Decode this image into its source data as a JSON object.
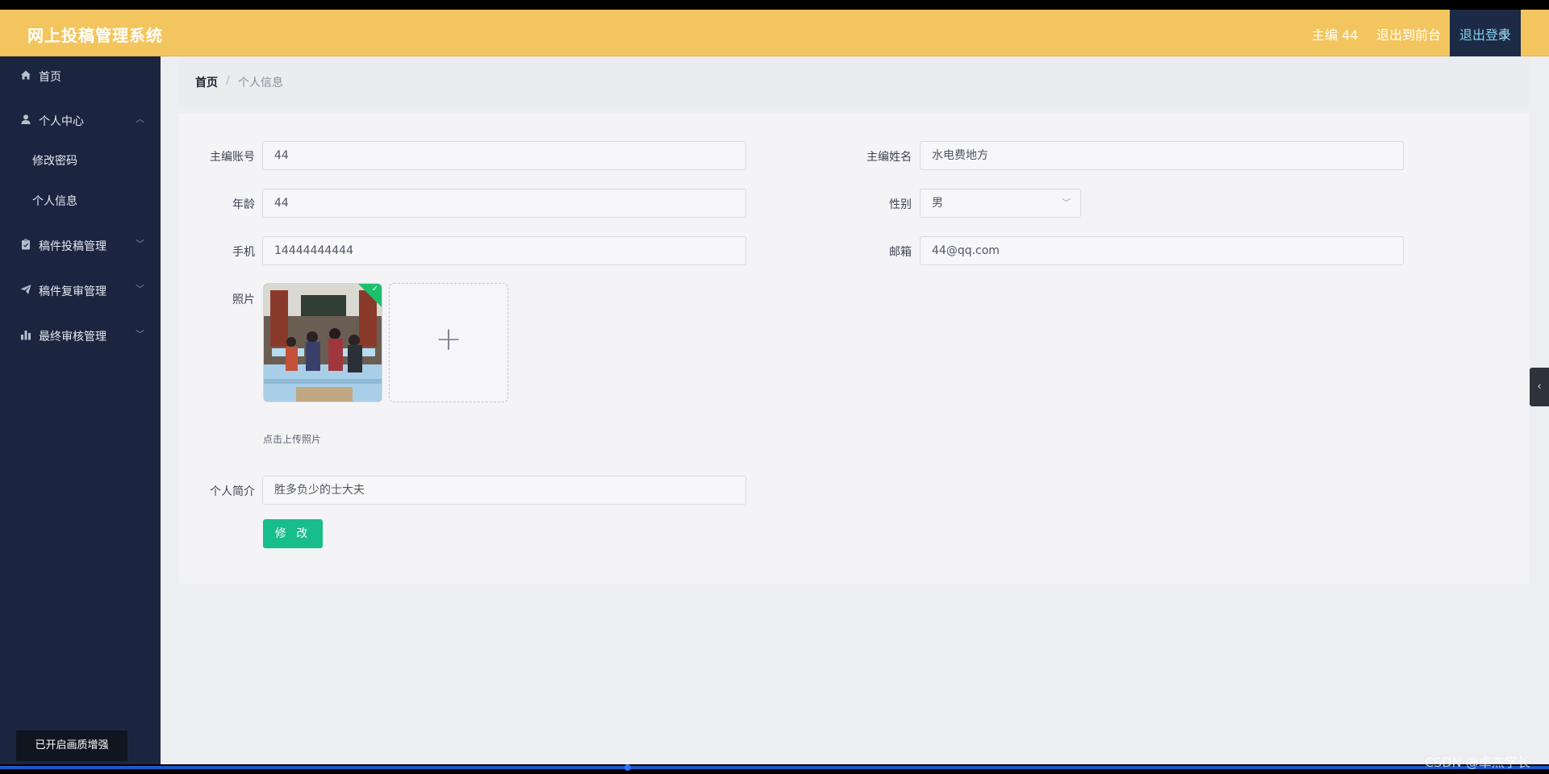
{
  "header": {
    "title": "网上投稿管理系统",
    "user": "主编 44",
    "front_link": "退出到前台",
    "logout": "退出登录"
  },
  "sidebar": {
    "items": [
      {
        "label": "首页",
        "icon": "home-icon"
      },
      {
        "label": "个人中心",
        "icon": "user-icon",
        "expanded": true,
        "children": [
          {
            "label": "修改密码"
          },
          {
            "label": "个人信息"
          }
        ]
      },
      {
        "label": "稿件投稿管理",
        "icon": "clipboard-icon"
      },
      {
        "label": "稿件复审管理",
        "icon": "paper-plane-icon"
      },
      {
        "label": "最终审核管理",
        "icon": "bar-chart-icon"
      }
    ],
    "badge": "已开启画质增强"
  },
  "breadcrumb": {
    "home": "首页",
    "separator": "/",
    "current": "个人信息"
  },
  "form": {
    "account": {
      "label": "主编账号",
      "value": "44"
    },
    "name": {
      "label": "主编姓名",
      "value": "水电费地方"
    },
    "age": {
      "label": "年龄",
      "value": "44"
    },
    "gender": {
      "label": "性别",
      "value": "男"
    },
    "phone": {
      "label": "手机",
      "value": "14444444444"
    },
    "email": {
      "label": "邮箱",
      "value": "44@qq.com"
    },
    "photo": {
      "label": "照片",
      "hint": "点击上传照片"
    },
    "bio": {
      "label": "个人简介",
      "value": "胜多负少的士大夫"
    },
    "submit": "修 改"
  },
  "colors": {
    "header_bg": "#f3c55e",
    "sidebar_bg": "#1c2540",
    "primary_button": "#17be8b",
    "upload_success": "#1bc06b"
  },
  "watermark": "CSDN @卓杰学长"
}
